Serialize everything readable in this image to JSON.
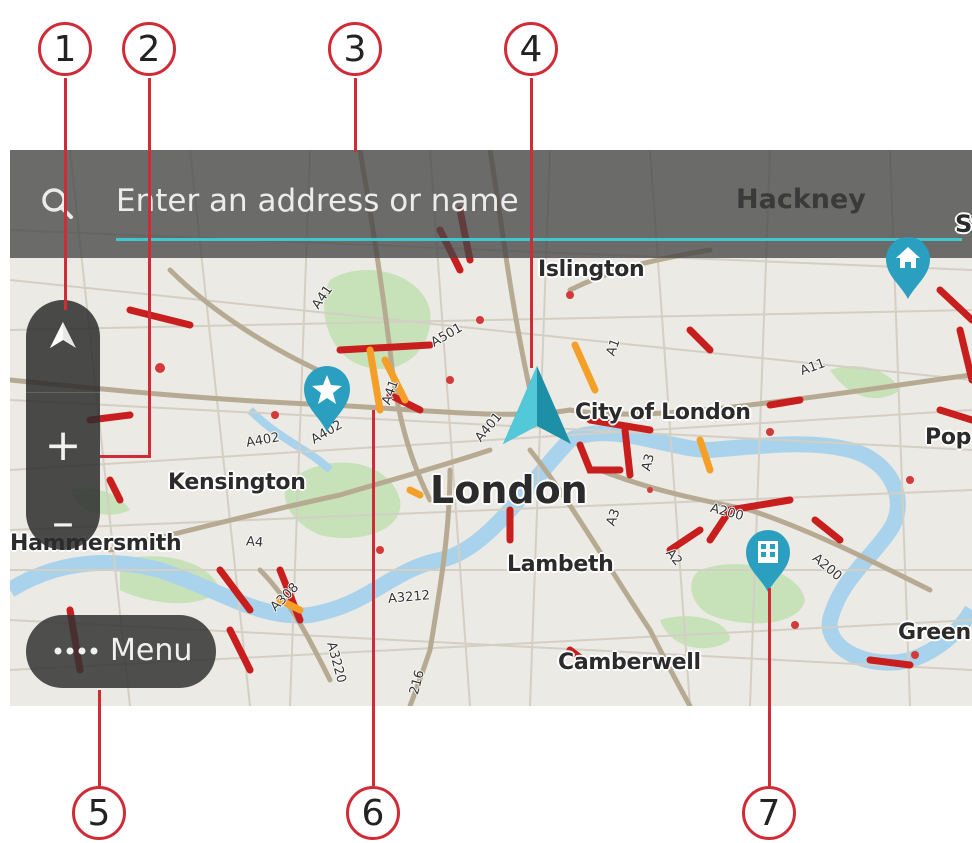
{
  "search": {
    "placeholder": "Enter an address or name",
    "right_label": "Hackney"
  },
  "map": {
    "places": {
      "islington": "Islington",
      "city_of_london": "City of London",
      "london": "London",
      "kensington": "Kensington",
      "hammersmith": "Hammersmith",
      "lambeth": "Lambeth",
      "camberwell": "Camberwell",
      "pop": "Pop",
      "green": "Green",
      "st": "St"
    },
    "roads": {
      "a41": "A41",
      "a501": "A501",
      "a1": "A1",
      "a11": "A11",
      "a402_left": "A402",
      "a402_right": "A402",
      "a41b": "A41",
      "a401": "A401",
      "a3": "A3",
      "a3b": "A3",
      "a200": "A200",
      "a200b": "A200",
      "a2": "A2",
      "a4": "A4",
      "a308": "A308",
      "a3212": "A3212",
      "a3220": "A3220",
      "a216": "216"
    }
  },
  "menu": {
    "label": "Menu"
  },
  "zoom": {
    "in_label": "+",
    "out_label": "–"
  },
  "callouts": [
    "1",
    "2",
    "3",
    "4",
    "5",
    "6",
    "7"
  ],
  "colors": {
    "accent": "#3ec7cf",
    "pin": "#2a9fc0",
    "callout": "#d02b36",
    "traffic_red": "#c81e1e",
    "traffic_orange": "#f4a028"
  },
  "icons": {
    "search": "search-icon",
    "north": "north-arrow-icon",
    "vehicle": "current-location-arrow-icon",
    "favourite": "star-pin-icon",
    "home": "home-pin-icon",
    "poi": "building-pin-icon"
  }
}
